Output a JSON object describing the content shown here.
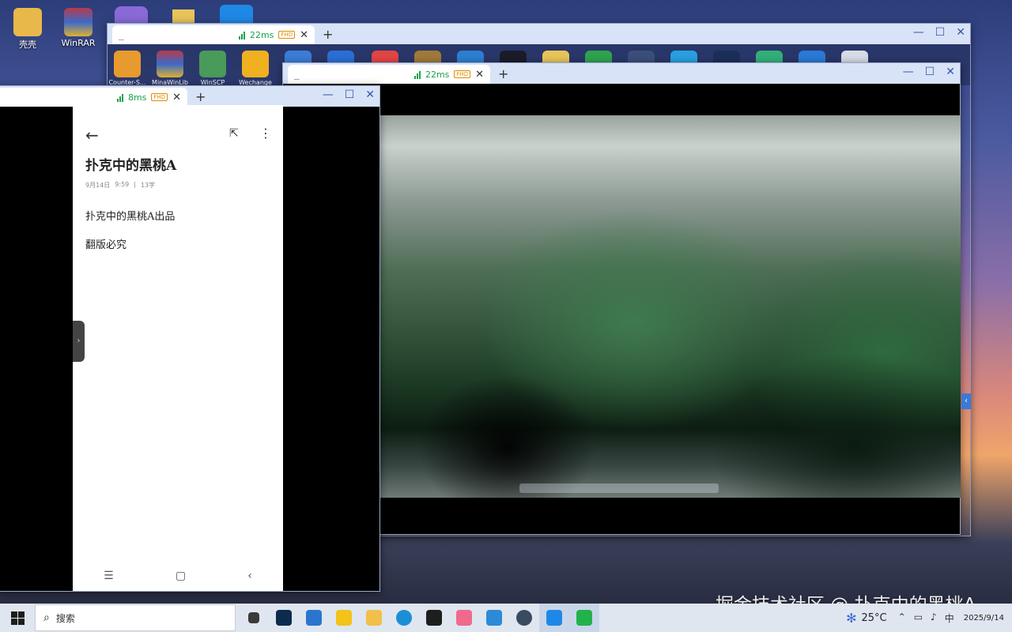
{
  "desktop": {
    "icons": [
      {
        "label": "壳壳",
        "icon": "user-folder-icon",
        "color": "#e8b84a"
      },
      {
        "label": "WinRAR",
        "icon": "winrar-icon",
        "color": "#b83a4b"
      }
    ]
  },
  "window_back": {
    "tab": {
      "title": "_",
      "ping": "22ms",
      "quality": "FHD"
    },
    "shortcuts": [
      {
        "label": "Counter-S...",
        "icon": "counter-strike-icon",
        "color": "#e79a2e"
      },
      {
        "label": "MinaWinLib",
        "icon": "winrar-icon",
        "color": "#b83a4b"
      },
      {
        "label": "WinSCP",
        "icon": "winscp-icon",
        "color": "#4a9a5a"
      },
      {
        "label": "Wechange",
        "icon": "wechange-icon",
        "color": "#f0b020"
      }
    ],
    "extra_icons": [
      "#3b7dd8",
      "#2b6fd6",
      "#e24545",
      "#a07a3a",
      "#2d7fd0",
      "#1c1c28",
      "#e8c55a",
      "#2ea44f",
      "#3b4f7a",
      "#28a0e0",
      "#1c2f5a",
      "#32b07a",
      "#2a7ad6",
      "#d7dce6"
    ]
  },
  "window_video": {
    "tab": {
      "title": "_",
      "ping": "22ms",
      "quality": "FHD"
    }
  },
  "window_phone": {
    "tab": {
      "ping": "8ms",
      "quality": "FHD"
    },
    "note": {
      "title": "扑克中的黑桃A",
      "date": "9月14日",
      "time": "9:59",
      "chars": "13字",
      "lines": [
        "扑克中的黑桃A出品",
        "翻版必究"
      ]
    }
  },
  "taskbar": {
    "search_placeholder": "搜索",
    "apps": [
      {
        "icon": "task-view-icon",
        "color": "#3a3a3a"
      },
      {
        "icon": "photoshop-icon",
        "color": "#0d2b4d"
      },
      {
        "icon": "store-icon",
        "color": "#2b75d0"
      },
      {
        "icon": "sticky-notes-icon",
        "color": "#f2c318"
      },
      {
        "icon": "file-explorer-icon",
        "color": "#f1c04a"
      },
      {
        "icon": "edge-icon",
        "color": "#1b8fd6"
      },
      {
        "icon": "pycharm-icon",
        "color": "#1e1e1e"
      },
      {
        "icon": "bilibili-icon",
        "color": "#f06a8e"
      },
      {
        "icon": "vscode-icon",
        "color": "#2c8ad8"
      },
      {
        "icon": "avatar-app-icon",
        "color": "#3a4a60"
      },
      {
        "icon": "todesk-icon",
        "color": "#1f88e6"
      },
      {
        "icon": "wechat-icon",
        "color": "#22b24a"
      }
    ],
    "weather": "25°C",
    "date": "2025/9/14"
  },
  "watermark": "掘金技术社区 @ 扑克中的黑桃A"
}
